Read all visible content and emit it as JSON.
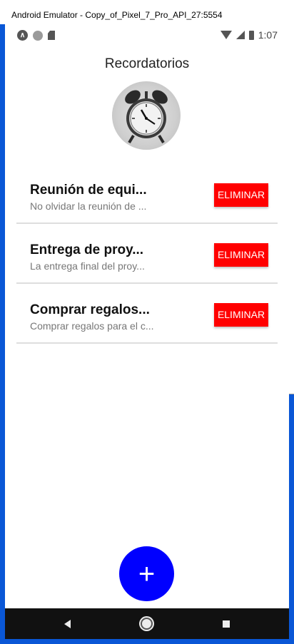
{
  "window": {
    "title": "Android Emulator - Copy_of_Pixel_7_Pro_API_27:5554"
  },
  "status_bar": {
    "time": "1:07",
    "left_icons": [
      "app-a-icon",
      "circle-icon",
      "sd-card-icon"
    ],
    "right_icons": [
      "wifi-icon",
      "signal-icon",
      "battery-icon"
    ]
  },
  "header": {
    "title": "Recordatorios",
    "avatar_icon": "alarm-clock-icon"
  },
  "reminders": [
    {
      "title": "Reunión de equi...",
      "subtitle": "No olvidar la reunión de ...",
      "delete_label": "ELIMINAR"
    },
    {
      "title": "Entrega de proy...",
      "subtitle": "La entrega final del proy...",
      "delete_label": "ELIMINAR"
    },
    {
      "title": "Comprar regalos...",
      "subtitle": "Comprar regalos para el c...",
      "delete_label": "ELIMINAR"
    }
  ],
  "fab": {
    "label": "+",
    "color": "#0000ff"
  },
  "colors": {
    "delete_button": "#ff0000",
    "window_border": "#0a57d6",
    "nav_bar": "#111111"
  },
  "nav_bar": {
    "icons": [
      "back-icon",
      "home-icon",
      "recents-icon"
    ]
  }
}
